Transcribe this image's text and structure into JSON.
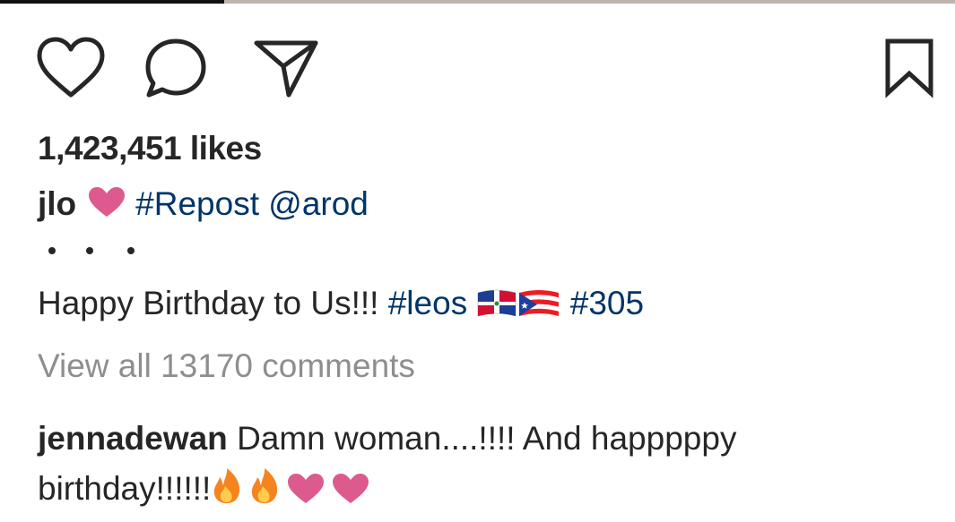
{
  "actions": {
    "like_icon": "heart-outline-icon",
    "comment_icon": "comment-bubble-icon",
    "share_icon": "paper-plane-icon",
    "save_icon": "bookmark-icon"
  },
  "likes_text": "1,423,451 likes",
  "caption": {
    "username": "jlo",
    "heart_emoji": "heart-icon",
    "repost_tag": "#Repost",
    "mention": "@arod",
    "text": "Happy Birthday to Us!!!",
    "hashtag_leos": "#leos",
    "flags": [
      "dominican-republic-flag",
      "puerto-rico-flag"
    ],
    "hashtag_305": "#305"
  },
  "view_all_comments": "View all 13170 comments",
  "comment": {
    "username": "jennadewan",
    "text_part1": "Damn woman....!!!! And happpppy",
    "text_part2": "birthday!!!!!!",
    "emojis": [
      "fire-icon",
      "fire-icon",
      "heart-icon",
      "heart-icon"
    ]
  },
  "colors": {
    "text": "#262626",
    "link": "#003569",
    "muted": "#8e8e8e",
    "heart_emoji": "#dd5a8e",
    "fire": "#f5841f"
  }
}
